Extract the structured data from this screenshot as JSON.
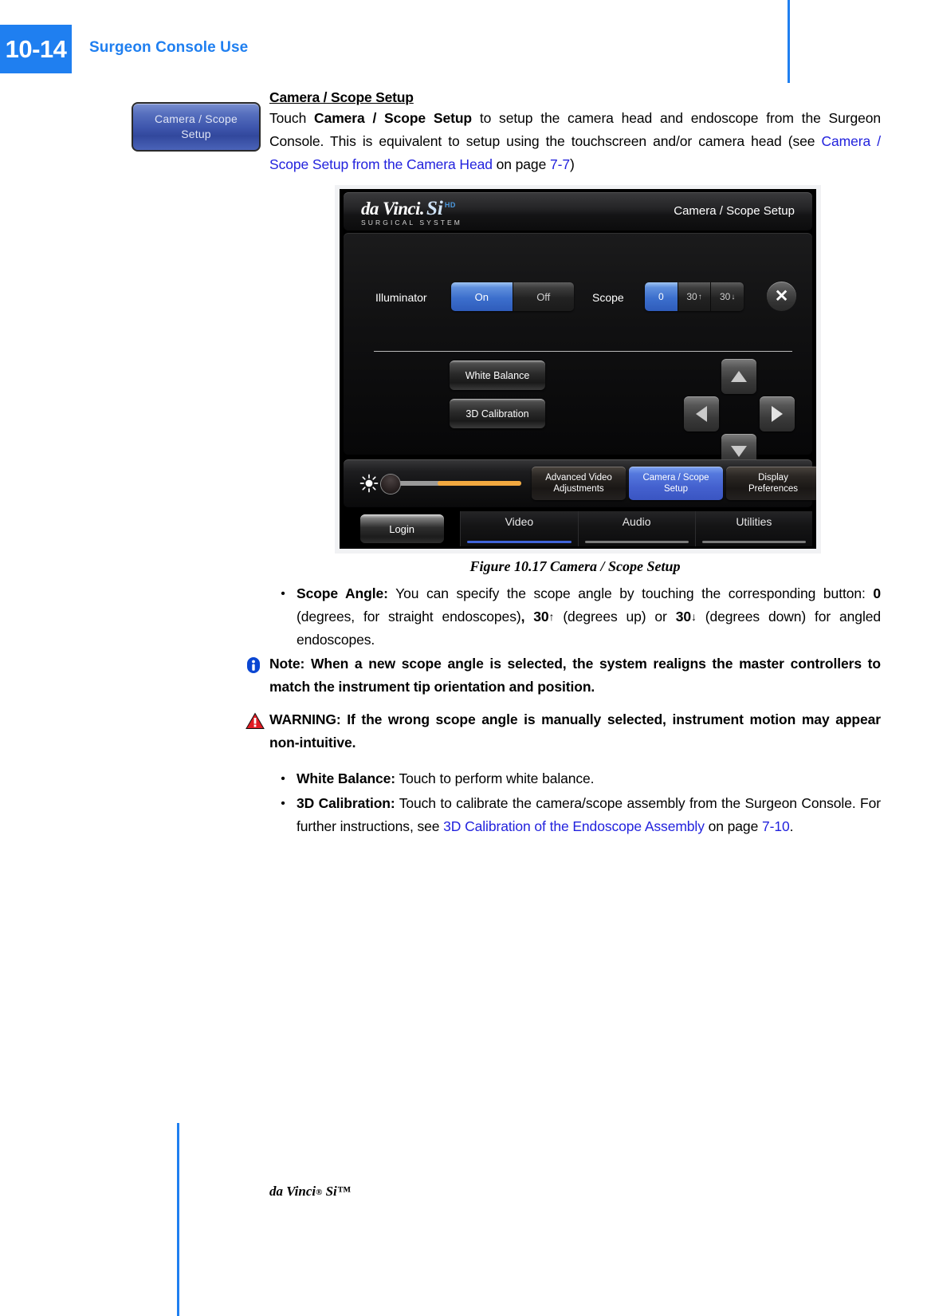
{
  "page": {
    "number": "10-14",
    "running_head": "Surgeon Console Use",
    "footer": "da Vinci",
    "footer_reg": "®",
    "footer_model": " Si™",
    "accent_color": "#1f7ff0",
    "link_color": "#2222dd"
  },
  "side_button": {
    "label_line1": "Camera / Scope",
    "label_line2": "Setup"
  },
  "section": {
    "heading": "Camera / Scope Setup",
    "para_1_a": "Touch ",
    "para_1_b": "Camera / Scope Setup",
    "para_1_c": " to setup the camera head and endoscope from the Surgeon Console. This is equivalent to setup using the touchscreen and/or camera head (see ",
    "para_1_link1": "Camera / Scope Setup from the Camera Head",
    "para_1_d": " on page ",
    "para_1_link2": "7-7",
    "para_1_e": ")"
  },
  "touchscreen": {
    "brand_name": "da Vinci",
    "brand_reg": ".",
    "brand_model": "Si",
    "brand_hd": "HD",
    "brand_subtitle": "SURGICAL SYSTEM",
    "title": "Camera / Scope Setup",
    "close_icon": "✕",
    "illuminator": {
      "label": "Illuminator",
      "options": [
        "On",
        "Off"
      ],
      "selected": "On"
    },
    "scope": {
      "label": "Scope",
      "options": [
        "0",
        "30",
        "30"
      ],
      "option_arrows": [
        "",
        "↑",
        "↓"
      ],
      "selected": "0"
    },
    "actions": {
      "white_balance": "White Balance",
      "calibration_3d": "3D Calibration"
    },
    "dpad": {
      "up": "up-arrow",
      "down": "down-arrow",
      "left": "left-arrow",
      "right": "right-arrow"
    },
    "brightness": {
      "icon": "brightness-sun-icon",
      "value_percent": 38
    },
    "toolbar": [
      {
        "line1": "Advanced Video",
        "line2": "Adjustments",
        "active": false
      },
      {
        "line1": "Camera / Scope",
        "line2": "Setup",
        "active": true
      },
      {
        "line1": "Display",
        "line2": "Preferences",
        "active": false
      }
    ],
    "tabs": [
      {
        "label": "Login",
        "type": "chip",
        "selected": false
      },
      {
        "label": "Video",
        "type": "tab",
        "selected": true
      },
      {
        "label": "Audio",
        "type": "tab",
        "selected": false
      },
      {
        "label": "Utilities",
        "type": "tab",
        "selected": false
      }
    ]
  },
  "figure": {
    "caption": "Figure 10.17 Camera / Scope Setup"
  },
  "bullets_1": [
    {
      "marker": "•",
      "bold": "Scope Angle:",
      "text_a": " You can specify the scope angle by touching the corresponding button: ",
      "bold_b": "0",
      "text_b": " (degrees, for straight endoscopes)",
      "bold_c": ", 30",
      "arrow_c": "↑",
      "text_c": " (degrees up) or ",
      "bold_d": "30",
      "arrow_d": "↓",
      "text_d": " (degrees down) for angled endoscopes."
    }
  ],
  "note": {
    "icon": "info-icon",
    "text": "Note: When a new scope angle is selected, the system realigns the master controllers to match the instrument tip orientation and position."
  },
  "warning": {
    "icon": "warning-triangle-icon",
    "label": "WARNING:",
    "text": " If the wrong scope angle is manually selected, instrument motion may appear non-intuitive."
  },
  "bullets_2": [
    {
      "marker": "•",
      "bold": "White Balance:",
      "text": " Touch to perform white balance."
    },
    {
      "marker": "•",
      "bold": "3D Calibration:",
      "text_a": " Touch to calibrate the camera/scope assembly from the Surgeon Console. For further instructions, see ",
      "link_a": "3D Calibration of the Endoscope Assembly",
      "text_b": " on page ",
      "link_b": "7-10",
      "text_c": "."
    }
  ]
}
